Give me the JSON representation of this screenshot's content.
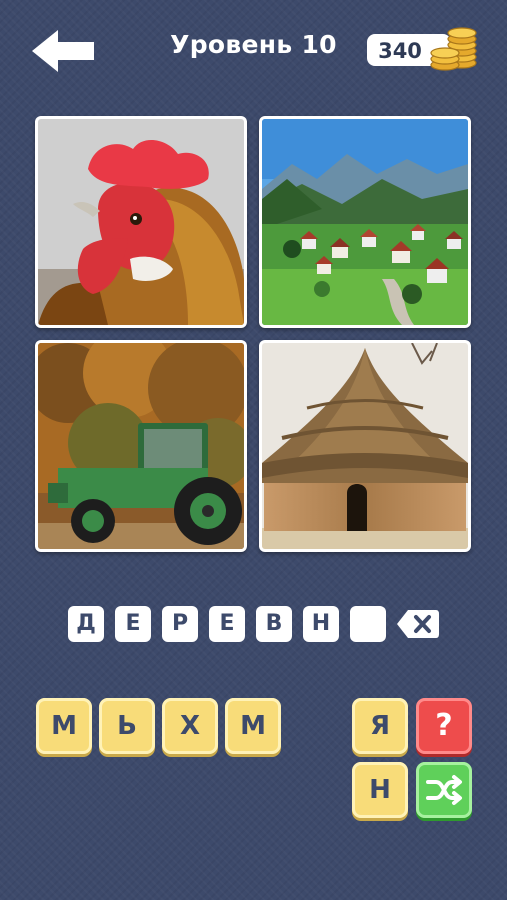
{
  "header": {
    "title": "Уровень 10",
    "coins": "340",
    "back_icon": "back-arrow-icon",
    "coin_icon": "coin-stack-icon"
  },
  "pictures": [
    {
      "name": "rooster"
    },
    {
      "name": "mountain-village"
    },
    {
      "name": "tractor"
    },
    {
      "name": "thatched-hut"
    }
  ],
  "answer": {
    "letters": [
      "Д",
      "Е",
      "Р",
      "Е",
      "В",
      "Н",
      ""
    ],
    "backspace_icon": "backspace-icon"
  },
  "keyboard": {
    "letters": [
      "М",
      "Ь",
      "Х",
      "М",
      "Я",
      "Н"
    ]
  },
  "hint_button": {
    "label": "?",
    "color": "#ee4c4c"
  },
  "shuffle_button": {
    "icon": "shuffle-icon",
    "color": "#5fd05a"
  },
  "colors": {
    "background": "#3d4a6b",
    "key": "#f8dc79",
    "text": "#3d4a6b"
  }
}
